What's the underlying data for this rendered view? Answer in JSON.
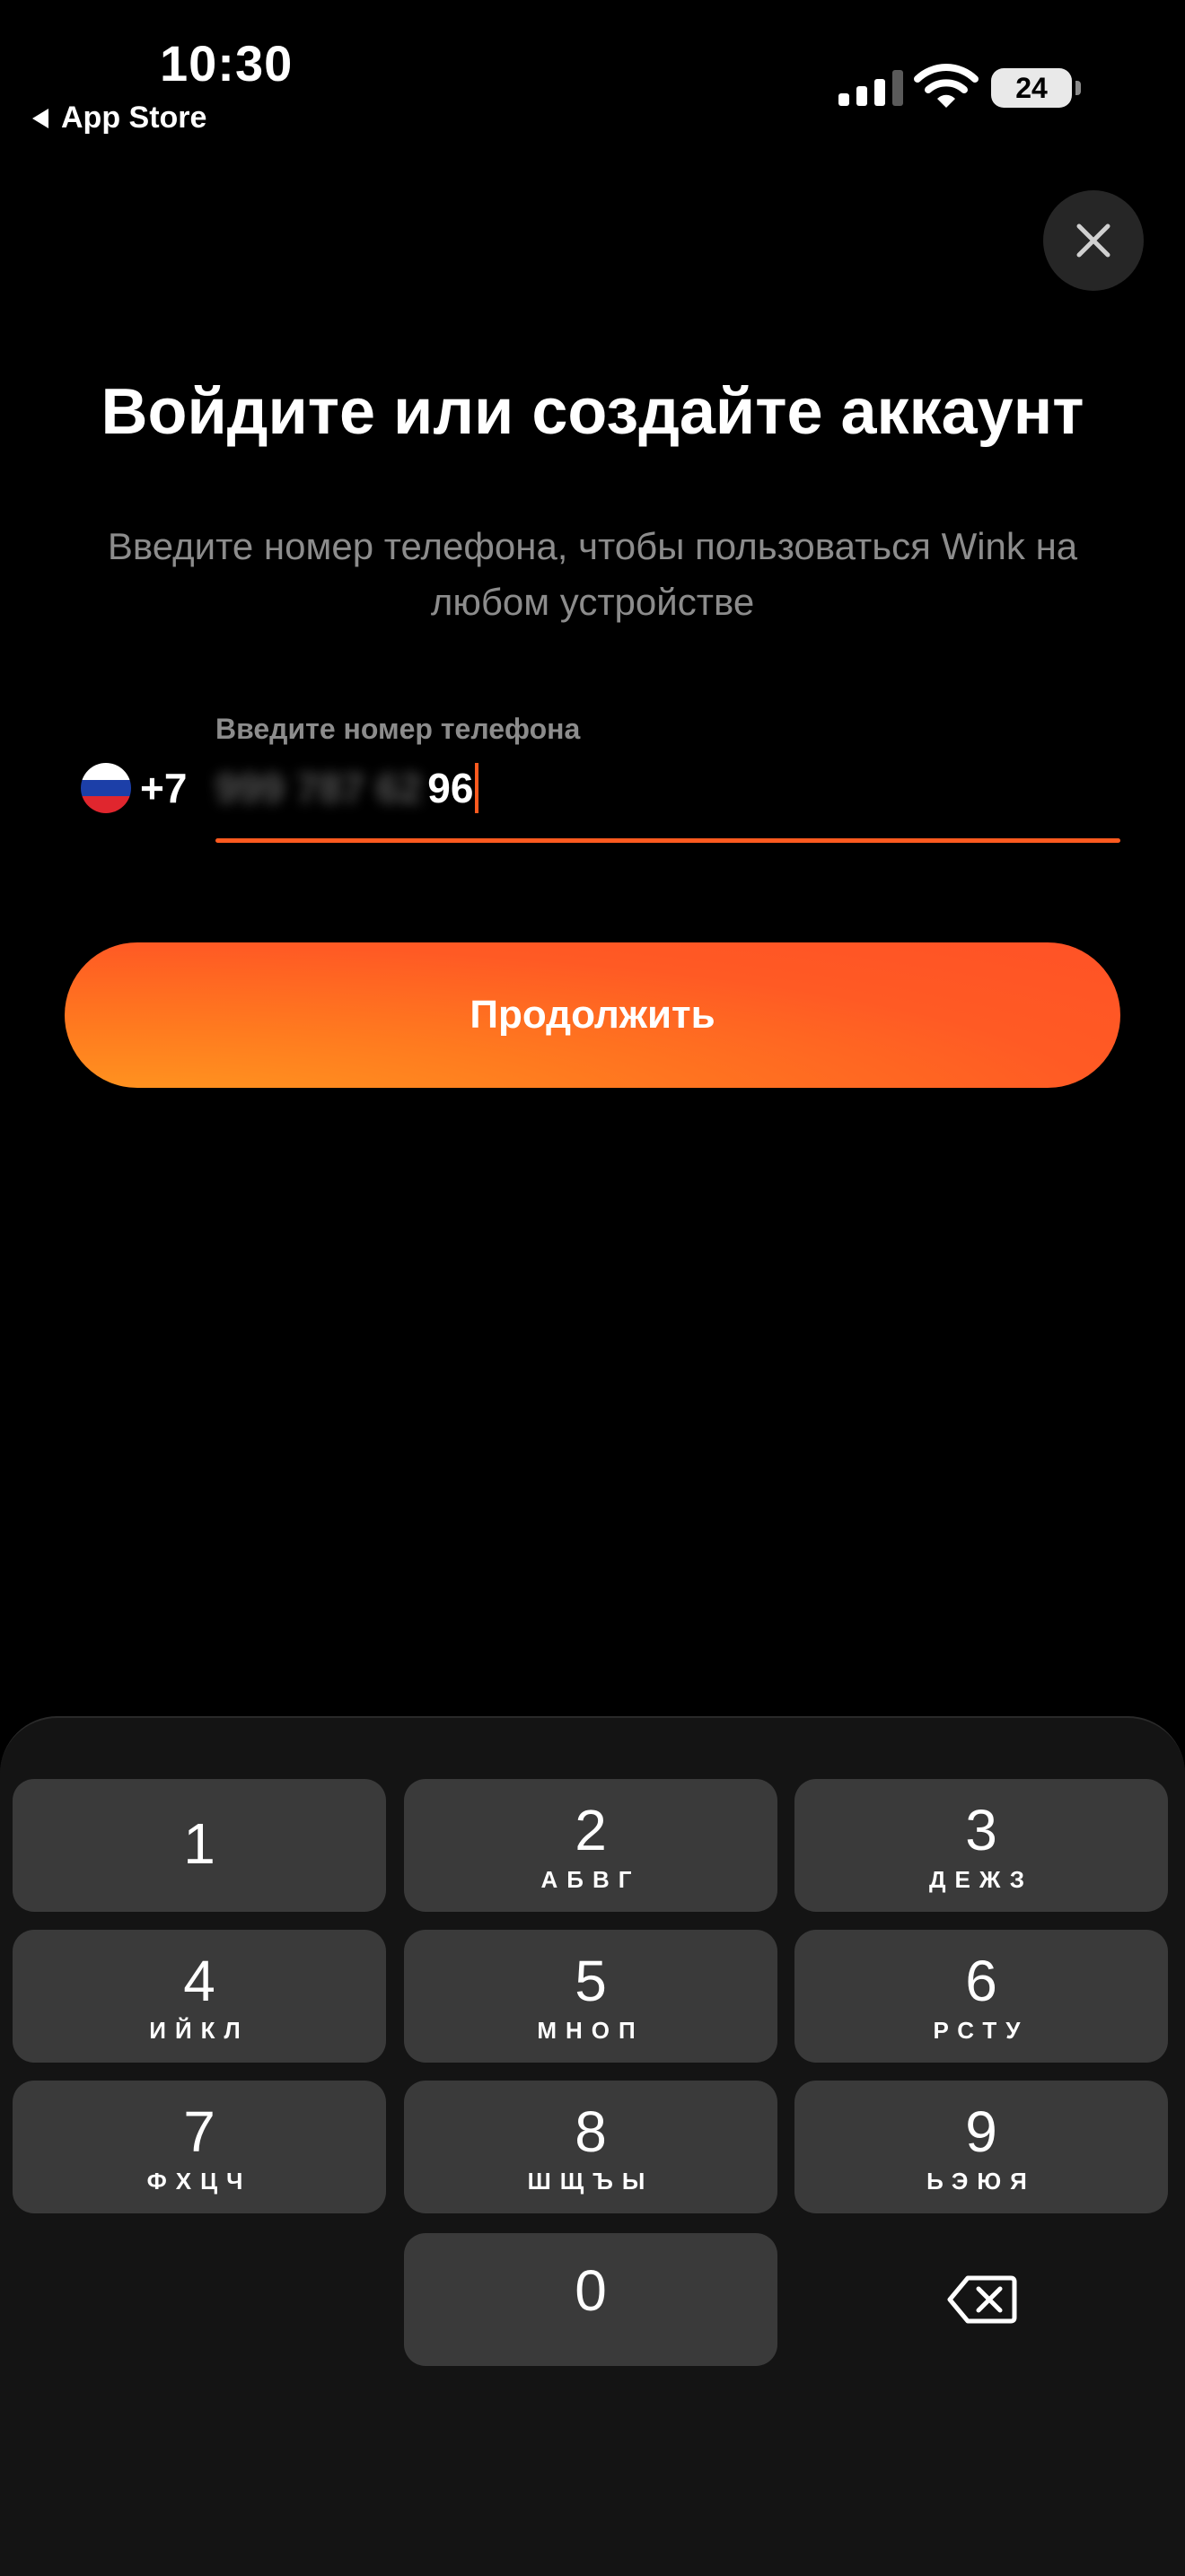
{
  "status_bar": {
    "time": "10:30",
    "back_app": "App Store",
    "battery": "24"
  },
  "title": "Войдите или создайте аккаунт",
  "subtitle": "Введите номер телефона, чтобы пользоваться Wink на любом устройстве",
  "phone": {
    "country_flag": "russia-flag-icon",
    "country_code": "+7",
    "label": "Введите номер телефона",
    "masked_value": "999 787 62",
    "visible_digits": "96"
  },
  "continue_button": "Продолжить",
  "keypad": [
    {
      "digit": "1",
      "letters": ""
    },
    {
      "digit": "2",
      "letters": "АБВГ"
    },
    {
      "digit": "3",
      "letters": "ДЕЖЗ"
    },
    {
      "digit": "4",
      "letters": "ИЙКЛ"
    },
    {
      "digit": "5",
      "letters": "МНОП"
    },
    {
      "digit": "6",
      "letters": "РСТУ"
    },
    {
      "digit": "7",
      "letters": "ФХЦЧ"
    },
    {
      "digit": "8",
      "letters": "ШЩЪЫ"
    },
    {
      "digit": "9",
      "letters": "ЬЭЮЯ"
    },
    {
      "digit": "0",
      "letters": ""
    }
  ],
  "colors": {
    "accent": "#ff5a1f",
    "background": "#000000",
    "key": "#3a3a3a"
  }
}
